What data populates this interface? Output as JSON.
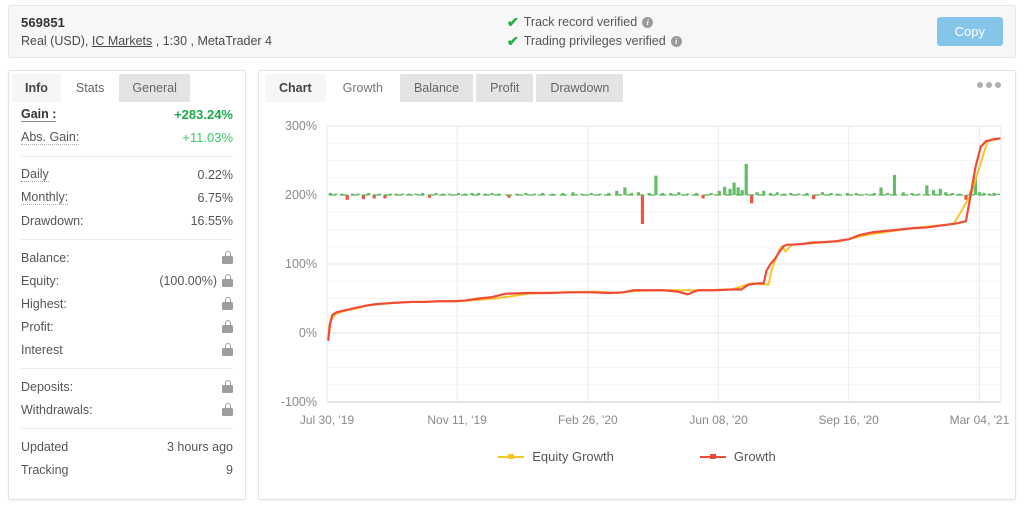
{
  "header": {
    "account_number": "569851",
    "account_meta_prefix": "Real (USD), ",
    "broker": "IC Markets",
    "account_meta_suffix": " , 1:30 , MetaTrader 4",
    "verifications": [
      {
        "label": "Track record verified",
        "info": "i"
      },
      {
        "label": "Trading privileges verified",
        "info": "i"
      }
    ],
    "copy_label": "Copy",
    "check_glyph": "✔",
    "accent_button_color": "#85c5ea",
    "verified_color": "#21b14b"
  },
  "sidebar": {
    "tabs": [
      {
        "label": "Info",
        "active": false
      },
      {
        "label": "Stats",
        "active": true
      },
      {
        "label": "General",
        "active": false
      }
    ],
    "group1": [
      {
        "key": "Gain :",
        "value": "+283.24%",
        "style": "gain-big",
        "underline": "solid"
      },
      {
        "key": "Abs. Gain:",
        "value": "+11.03%",
        "style": "gain-sm",
        "underline": "dotted"
      }
    ],
    "group2": [
      {
        "key": "Daily",
        "value": "0.22%",
        "underline": "dotted"
      },
      {
        "key": "Monthly:",
        "value": "6.75%",
        "underline": "dotted"
      },
      {
        "key": "Drawdown:",
        "value": "16.55%",
        "underline": "none"
      }
    ],
    "group3": [
      {
        "key": "Balance:",
        "value": "",
        "locked": true
      },
      {
        "key": "Equity:",
        "value": "(100.00%)",
        "locked": true
      },
      {
        "key": "Highest:",
        "value": "",
        "locked": true
      },
      {
        "key": "Profit:",
        "value": "",
        "locked": true
      },
      {
        "key": "Interest",
        "value": "",
        "locked": true
      }
    ],
    "group4": [
      {
        "key": "Deposits:",
        "value": "",
        "locked": true
      },
      {
        "key": "Withdrawals:",
        "value": "",
        "locked": true
      }
    ],
    "group5": [
      {
        "key": "Updated",
        "value": "3 hours ago",
        "locked": false
      },
      {
        "key": "Tracking",
        "value": "9",
        "locked": false
      }
    ]
  },
  "chart_panel": {
    "tabs": [
      {
        "label": "Chart",
        "active": false
      },
      {
        "label": "Growth",
        "active": true
      },
      {
        "label": "Balance",
        "active": false
      },
      {
        "label": "Profit",
        "active": false
      },
      {
        "label": "Drawdown",
        "active": false
      }
    ],
    "menu_icon": "three-dots"
  },
  "chart_data": {
    "type": "line",
    "title": "",
    "xlabel": "",
    "ylabel": "",
    "ylim": [
      -100,
      300
    ],
    "yticks": [
      300,
      200,
      100,
      0,
      -100
    ],
    "ytick_labels": [
      "300%",
      "200%",
      "100%",
      "0%",
      "-100%"
    ],
    "xtick_labels": [
      "Jul 30, '19",
      "Nov 11, '19",
      "Feb 26, '20",
      "Jun 08, '20",
      "Sep 16, '20",
      "Mar 04, '21"
    ],
    "xtick_positions": [
      0,
      0.193,
      0.387,
      0.581,
      0.774,
      0.968
    ],
    "grid": true,
    "legend_position": "bottom",
    "colors": {
      "growth": "#ef4b37",
      "equity_growth": "#f7c52a",
      "profit_bar_positive": "#5cb85c",
      "profit_bar_negative": "#ef4b37",
      "grid": "#eeeeee",
      "axis_text": "#8a8a8a"
    },
    "series": [
      {
        "name": "Equity Growth",
        "color": "#f7c52a",
        "points": [
          [
            0.002,
            -8
          ],
          [
            0.006,
            18
          ],
          [
            0.012,
            27
          ],
          [
            0.02,
            30
          ],
          [
            0.03,
            33
          ],
          [
            0.045,
            36
          ],
          [
            0.06,
            40
          ],
          [
            0.08,
            42
          ],
          [
            0.1,
            44
          ],
          [
            0.13,
            45
          ],
          [
            0.17,
            46
          ],
          [
            0.21,
            47
          ],
          [
            0.25,
            50
          ],
          [
            0.3,
            57
          ],
          [
            0.35,
            59
          ],
          [
            0.4,
            60
          ],
          [
            0.43,
            58
          ],
          [
            0.46,
            61
          ],
          [
            0.5,
            62
          ],
          [
            0.55,
            62
          ],
          [
            0.6,
            63
          ],
          [
            0.63,
            72
          ],
          [
            0.655,
            70
          ],
          [
            0.66,
            92
          ],
          [
            0.67,
            118
          ],
          [
            0.675,
            126
          ],
          [
            0.68,
            118
          ],
          [
            0.69,
            128
          ],
          [
            0.72,
            130
          ],
          [
            0.76,
            133
          ],
          [
            0.8,
            142
          ],
          [
            0.84,
            148
          ],
          [
            0.87,
            152
          ],
          [
            0.9,
            155
          ],
          [
            0.93,
            158
          ],
          [
            0.955,
            200
          ],
          [
            0.98,
            278
          ],
          [
            0.995,
            281
          ]
        ]
      },
      {
        "name": "Growth",
        "color": "#ef4b37",
        "points": [
          [
            0.002,
            -10
          ],
          [
            0.004,
            12
          ],
          [
            0.008,
            26
          ],
          [
            0.014,
            30
          ],
          [
            0.022,
            32
          ],
          [
            0.032,
            34
          ],
          [
            0.045,
            37
          ],
          [
            0.06,
            40
          ],
          [
            0.075,
            42
          ],
          [
            0.09,
            43
          ],
          [
            0.105,
            44
          ],
          [
            0.125,
            45
          ],
          [
            0.145,
            45
          ],
          [
            0.165,
            46
          ],
          [
            0.19,
            46
          ],
          [
            0.205,
            47
          ],
          [
            0.225,
            50
          ],
          [
            0.245,
            52
          ],
          [
            0.265,
            57
          ],
          [
            0.3,
            58
          ],
          [
            0.33,
            58
          ],
          [
            0.36,
            59
          ],
          [
            0.39,
            59
          ],
          [
            0.42,
            58
          ],
          [
            0.44,
            59
          ],
          [
            0.455,
            62
          ],
          [
            0.475,
            62
          ],
          [
            0.5,
            62
          ],
          [
            0.52,
            60
          ],
          [
            0.535,
            56
          ],
          [
            0.55,
            62
          ],
          [
            0.575,
            62
          ],
          [
            0.6,
            63
          ],
          [
            0.615,
            63
          ],
          [
            0.625,
            70
          ],
          [
            0.64,
            72
          ],
          [
            0.648,
            72
          ],
          [
            0.652,
            90
          ],
          [
            0.658,
            100
          ],
          [
            0.665,
            108
          ],
          [
            0.672,
            119
          ],
          [
            0.678,
            126
          ],
          [
            0.682,
            128
          ],
          [
            0.69,
            128
          ],
          [
            0.705,
            129
          ],
          [
            0.72,
            131
          ],
          [
            0.74,
            132
          ],
          [
            0.755,
            133
          ],
          [
            0.775,
            136
          ],
          [
            0.79,
            142
          ],
          [
            0.81,
            146
          ],
          [
            0.83,
            148
          ],
          [
            0.85,
            150
          ],
          [
            0.87,
            152
          ],
          [
            0.89,
            153
          ],
          [
            0.905,
            155
          ],
          [
            0.92,
            157
          ],
          [
            0.935,
            159
          ],
          [
            0.948,
            162
          ],
          [
            0.955,
            200
          ],
          [
            0.962,
            240
          ],
          [
            0.97,
            270
          ],
          [
            0.978,
            278
          ],
          [
            0.99,
            281
          ],
          [
            0.998,
            282
          ]
        ]
      }
    ],
    "profit_bars_baseline": 200,
    "profit_bars": [
      [
        0.005,
        3
      ],
      [
        0.013,
        2
      ],
      [
        0.022,
        2
      ],
      [
        0.03,
        -7
      ],
      [
        0.038,
        2
      ],
      [
        0.046,
        2
      ],
      [
        0.054,
        -6
      ],
      [
        0.062,
        3
      ],
      [
        0.07,
        -5
      ],
      [
        0.078,
        2
      ],
      [
        0.086,
        -5
      ],
      [
        0.094,
        2
      ],
      [
        0.102,
        2
      ],
      [
        0.112,
        2
      ],
      [
        0.122,
        2
      ],
      [
        0.132,
        2
      ],
      [
        0.142,
        3
      ],
      [
        0.152,
        -4
      ],
      [
        0.162,
        3
      ],
      [
        0.172,
        2
      ],
      [
        0.182,
        2
      ],
      [
        0.195,
        3
      ],
      [
        0.205,
        2
      ],
      [
        0.215,
        3
      ],
      [
        0.225,
        3
      ],
      [
        0.235,
        2
      ],
      [
        0.245,
        3
      ],
      [
        0.255,
        2
      ],
      [
        0.27,
        -4
      ],
      [
        0.282,
        2
      ],
      [
        0.295,
        3
      ],
      [
        0.308,
        2
      ],
      [
        0.32,
        3
      ],
      [
        0.335,
        2
      ],
      [
        0.35,
        3
      ],
      [
        0.365,
        4
      ],
      [
        0.378,
        2
      ],
      [
        0.392,
        3
      ],
      [
        0.405,
        2
      ],
      [
        0.418,
        3
      ],
      [
        0.43,
        6
      ],
      [
        0.442,
        11
      ],
      [
        0.452,
        3
      ],
      [
        0.462,
        4
      ],
      [
        0.468,
        -42
      ],
      [
        0.478,
        3
      ],
      [
        0.488,
        28
      ],
      [
        0.498,
        3
      ],
      [
        0.51,
        3
      ],
      [
        0.522,
        4
      ],
      [
        0.535,
        2
      ],
      [
        0.548,
        3
      ],
      [
        0.558,
        -5
      ],
      [
        0.57,
        3
      ],
      [
        0.582,
        6
      ],
      [
        0.59,
        12
      ],
      [
        0.598,
        9
      ],
      [
        0.604,
        18
      ],
      [
        0.61,
        11
      ],
      [
        0.616,
        7
      ],
      [
        0.622,
        45
      ],
      [
        0.63,
        -12
      ],
      [
        0.638,
        4
      ],
      [
        0.648,
        6
      ],
      [
        0.658,
        3
      ],
      [
        0.668,
        4
      ],
      [
        0.678,
        2
      ],
      [
        0.688,
        3
      ],
      [
        0.7,
        2
      ],
      [
        0.712,
        3
      ],
      [
        0.722,
        -6
      ],
      [
        0.735,
        4
      ],
      [
        0.748,
        3
      ],
      [
        0.758,
        2
      ],
      [
        0.772,
        3
      ],
      [
        0.785,
        3
      ],
      [
        0.8,
        2
      ],
      [
        0.812,
        3
      ],
      [
        0.822,
        11
      ],
      [
        0.832,
        3
      ],
      [
        0.842,
        29
      ],
      [
        0.855,
        4
      ],
      [
        0.868,
        3
      ],
      [
        0.878,
        2
      ],
      [
        0.89,
        14
      ],
      [
        0.9,
        7
      ],
      [
        0.91,
        9
      ],
      [
        0.918,
        4
      ],
      [
        0.928,
        3
      ],
      [
        0.938,
        2
      ],
      [
        0.948,
        -7
      ],
      [
        0.955,
        5
      ],
      [
        0.962,
        26
      ],
      [
        0.968,
        4
      ],
      [
        0.975,
        3
      ],
      [
        0.982,
        2
      ],
      [
        0.99,
        3
      ],
      [
        0.996,
        2
      ]
    ],
    "legend": [
      {
        "name": "Equity Growth",
        "color": "#f7c52a"
      },
      {
        "name": "Growth",
        "color": "#ef4b37"
      }
    ]
  }
}
